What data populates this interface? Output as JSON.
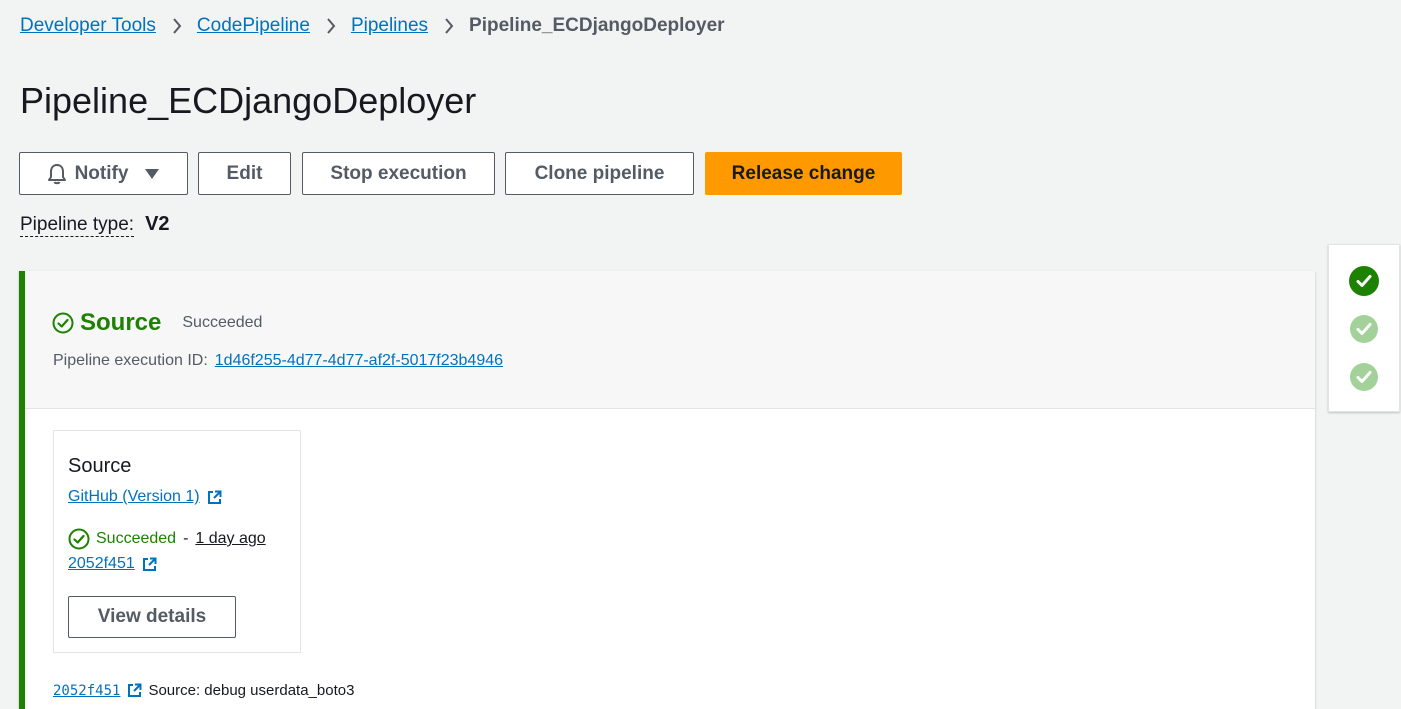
{
  "breadcrumb": {
    "items": [
      "Developer Tools",
      "CodePipeline",
      "Pipelines"
    ],
    "current": "Pipeline_ECDjangoDeployer"
  },
  "page": {
    "title": "Pipeline_ECDjangoDeployer"
  },
  "toolbar": {
    "notify_label": "Notify",
    "edit_label": "Edit",
    "stop_label": "Stop execution",
    "clone_label": "Clone pipeline",
    "release_label": "Release change"
  },
  "pipeline_type": {
    "label": "Pipeline type:",
    "value": "V2"
  },
  "stage": {
    "name": "Source",
    "status": "Succeeded",
    "exec_id_label": "Pipeline execution ID:",
    "exec_id": "1d46f255-4d77-4d77-af2f-5017f23b4946",
    "action": {
      "title": "Source",
      "provider": "GitHub (Version 1)",
      "status": "Succeeded",
      "separator": "-",
      "time_ago": "1 day ago",
      "commit": "2052f451",
      "view_details_label": "View details"
    },
    "commit_line": {
      "hash": "2052f451",
      "message": "Source: debug userdata_boto3"
    }
  },
  "mini_nav": {
    "stages": [
      "succeeded-current",
      "succeeded",
      "succeeded"
    ]
  },
  "colors": {
    "link": "#0073bb",
    "success": "#1d8102",
    "primary": "#ff9900",
    "success_faded": "#a3d19a"
  }
}
